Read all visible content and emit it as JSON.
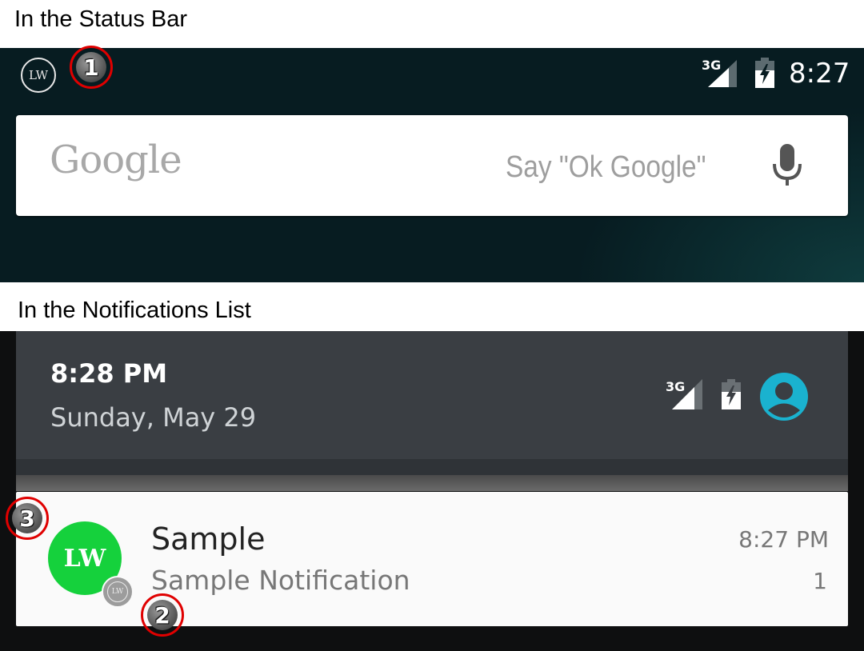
{
  "captions": {
    "status_bar": "In the Status Bar",
    "notifications_list": "In the Notifications List"
  },
  "markers": [
    "1",
    "2",
    "3"
  ],
  "status_bar": {
    "app_badge": "LW",
    "network": "3G",
    "time": "8:27",
    "icons": [
      "lw-badge-icon",
      "cell-signal-icon",
      "battery-charging-icon"
    ]
  },
  "search": {
    "logo": "Google",
    "hint": "Say \"Ok Google\"",
    "icon": "microphone-icon"
  },
  "shade_header": {
    "time": "8:28 PM",
    "date": "Sunday, May 29",
    "network": "3G",
    "icons": [
      "cell-signal-icon",
      "battery-charging-icon",
      "user-account-icon"
    ]
  },
  "notification": {
    "large_icon": "LW",
    "small_icon": "LW",
    "title": "Sample",
    "text": "Sample Notification",
    "time": "8:27 PM",
    "number": "1"
  },
  "colors": {
    "status_bg": "#071c21",
    "shade_header": "#3a3e43",
    "notification_avatar": "#15d13c",
    "account_icon": "#1ab2cf",
    "marker_ring": "#e00000"
  }
}
